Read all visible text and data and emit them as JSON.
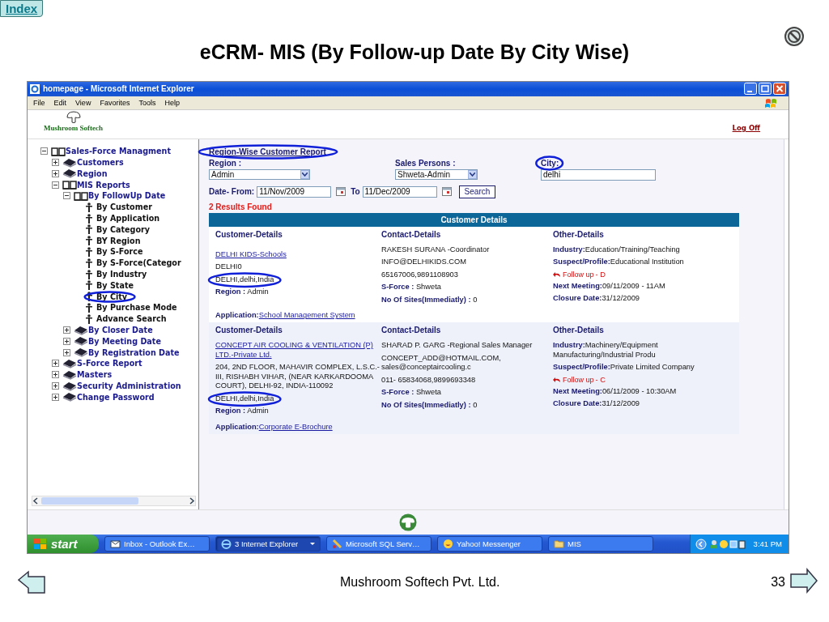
{
  "slide": {
    "index_link": "Index",
    "title": "eCRM- MIS (By Follow-up Date By City Wise)",
    "footer": "Mushroom Softech Pvt. Ltd.",
    "page_number": "33"
  },
  "window": {
    "title": "homepage - Microsoft Internet Explorer",
    "menu": [
      "File",
      "Edit",
      "View",
      "Favorites",
      "Tools",
      "Help"
    ]
  },
  "site": {
    "logo": "Mushroom Softech",
    "log_off": "Log Off"
  },
  "tree": [
    {
      "label": "Sales-Force Managment",
      "expanded": true,
      "children": [
        {
          "label": "Customers",
          "expanded": false
        },
        {
          "label": "Region",
          "expanded": false
        },
        {
          "label": "MIS Reports",
          "expanded": true,
          "children": [
            {
              "label": "By FollowUp Date",
              "expanded": true,
              "children": [
                {
                  "label": "By Customer",
                  "highlighted": false
                },
                {
                  "label": "By Application",
                  "highlighted": false
                },
                {
                  "label": "By Category",
                  "highlighted": false
                },
                {
                  "label": "BY Region",
                  "highlighted": false
                },
                {
                  "label": "By S-Force",
                  "highlighted": false
                },
                {
                  "label": "By S-Force(Categor",
                  "highlighted": false
                },
                {
                  "label": "By Industry",
                  "highlighted": false
                },
                {
                  "label": "By State",
                  "highlighted": false
                },
                {
                  "label": "By City",
                  "highlighted": true
                },
                {
                  "label": "By Purchase Mode",
                  "highlighted": false
                },
                {
                  "label": "Advance Search",
                  "highlighted": false
                }
              ]
            },
            {
              "label": "By Closer Date",
              "expanded": false
            },
            {
              "label": "By Meeting Date",
              "expanded": false
            },
            {
              "label": "By Registration Date",
              "expanded": false
            }
          ]
        },
        {
          "label": "S-Force Report",
          "expanded": false
        },
        {
          "label": "Masters",
          "expanded": false
        },
        {
          "label": "Security Administration",
          "expanded": false
        },
        {
          "label": "Change Password",
          "expanded": false
        }
      ]
    }
  ],
  "report": {
    "title": {
      "text": "Region-Wise Customer Report",
      "highlighted": true
    },
    "region": {
      "label": "Region :",
      "value": "Admin",
      "highlighted": false
    },
    "sales_person": {
      "label": "Sales Persons :",
      "value": "Shweta-Admin",
      "highlighted": false
    },
    "city": {
      "label": "City:",
      "value": "delhi",
      "highlighted": true
    },
    "date_from": {
      "label": "Date- From:",
      "value": "11/Nov/2009"
    },
    "date_to": {
      "label": "To",
      "value": "11/Dec/2009"
    },
    "search_button": "Search",
    "result_count": "2 Results Found",
    "table_title": "Customer Details",
    "records": [
      {
        "headings": [
          "Customer-Details",
          "Contact-Details",
          "Other-Details"
        ],
        "company": "DELHI KIDS-Schools",
        "address_lines": [
          {
            "text": "DELHI0",
            "highlighted": false
          },
          {
            "text": "DELHI,delhi,India",
            "highlighted": true
          }
        ],
        "region": "**Region :** Admin",
        "contact_lines": [
          "RAKESH SURANA -Coordinator",
          "INFO@DELHIKIDS.COM",
          "65167006,9891108903",
          "**S-Force :** Shweta",
          "**No Of Sites(Immediatly) :** 0"
        ],
        "other_lines": [
          "**Industry:**Education/Training/Teaching",
          "**Suspect/Profile:**Educational Institution"
        ],
        "follow_up": "Follow up",
        "follow_up_grade": "- D",
        "after_lines": [
          "**Next Meeting:**09/11/2009 - 11AM",
          "**Closure Date:**31/12/2009"
        ],
        "application_label": "Application:",
        "application": "School Management System"
      },
      {
        "headings": [
          "Customer-Details",
          "Contact-Details",
          "Other-Details"
        ],
        "company": "CONCEPT AIR COOLING & VENTILATION (P) LTD.-Private Ltd.",
        "address_lines": [
          {
            "text": "204, 2ND FLOOR, MAHAVIR COMPLEX, L.S.C.-III, RISHABH VIHAR, (NEAR KARKARDOOMA COURT), DELHI-92, INDIA-110092",
            "highlighted": false
          },
          {
            "text": "DELHI,delhi,India",
            "highlighted": true
          }
        ],
        "region": "**Region :** Admin",
        "contact_lines": [
          "SHARAD P. GARG -Regional Sales Manager",
          "CONCEPT_ADD@HOTMAIL.COM, sales@conceptaircooling.c",
          "011- 65834068,9899693348",
          "**S-Force :** Shweta",
          "**No Of Sites(Immediatly) :** 0"
        ],
        "other_lines": [
          "**Industry:**Machinery/Equipment Manufacturing/Industrial Produ",
          "**Suspect/Profile:**Private Limited Company"
        ],
        "follow_up": "Follow up",
        "follow_up_grade": "- C",
        "after_lines": [
          "**Next Meeting:**06/11/2009 - 10:30AM",
          "**Closure Date:**31/12/2009"
        ],
        "application_label": "Application:",
        "application": "Corporate E-Brochure"
      }
    ]
  },
  "taskbar": {
    "start": "start",
    "tasks": [
      {
        "label": "Inbox - Outlook Ex…",
        "kind": "mail",
        "selected": false
      },
      {
        "label": "3 Internet Explorer",
        "kind": "browser",
        "selected": true
      },
      {
        "label": "Microsoft SQL Serv…",
        "kind": "tool",
        "selected": false
      },
      {
        "label": "Yahoo! Messenger",
        "kind": "smiley",
        "selected": false
      },
      {
        "label": "MIS",
        "kind": "folder",
        "selected": false
      }
    ],
    "clock": "3:41 PM"
  }
}
